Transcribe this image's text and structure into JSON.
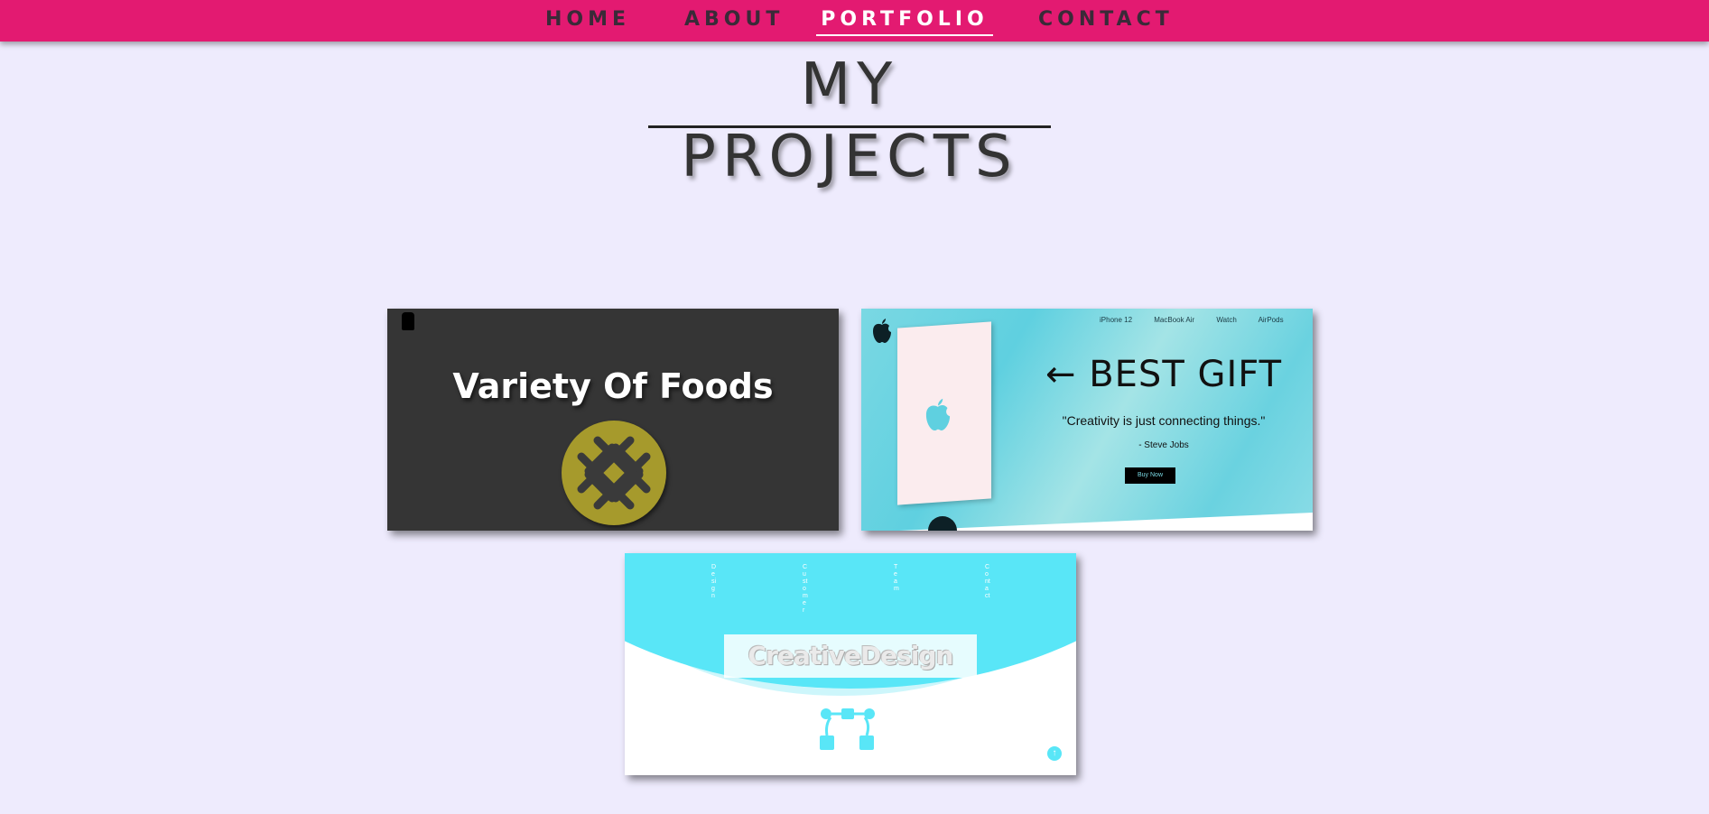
{
  "nav": {
    "items": [
      {
        "label": "HOME"
      },
      {
        "label": "ABOUT"
      },
      {
        "label": "PORTFOLIO"
      },
      {
        "label": "CONTACT"
      }
    ],
    "active": "PORTFOLIO"
  },
  "main": {
    "title": "MY PROJECTS"
  },
  "projects": {
    "food": {
      "heading": "Variety Of Foods"
    },
    "apple": {
      "links": [
        "iPhone 12",
        "MacBook Air",
        "Watch",
        "AirPods"
      ],
      "headline": "← BEST GIFT",
      "quote": "\"Creativity is just connecting things.\"",
      "author": "- Steve Jobs",
      "button": "Buy Now"
    },
    "creative": {
      "nav_items": [
        "Design",
        "Customer",
        "Team",
        "Contact"
      ],
      "banner": "CreativeDesign",
      "scroll_top": "↑"
    }
  },
  "colors": {
    "nav_bg": "#e31a71",
    "page_bg": "#eeebfd",
    "cyan_accent": "#59e6f7",
    "pie": "#a69a2c"
  }
}
